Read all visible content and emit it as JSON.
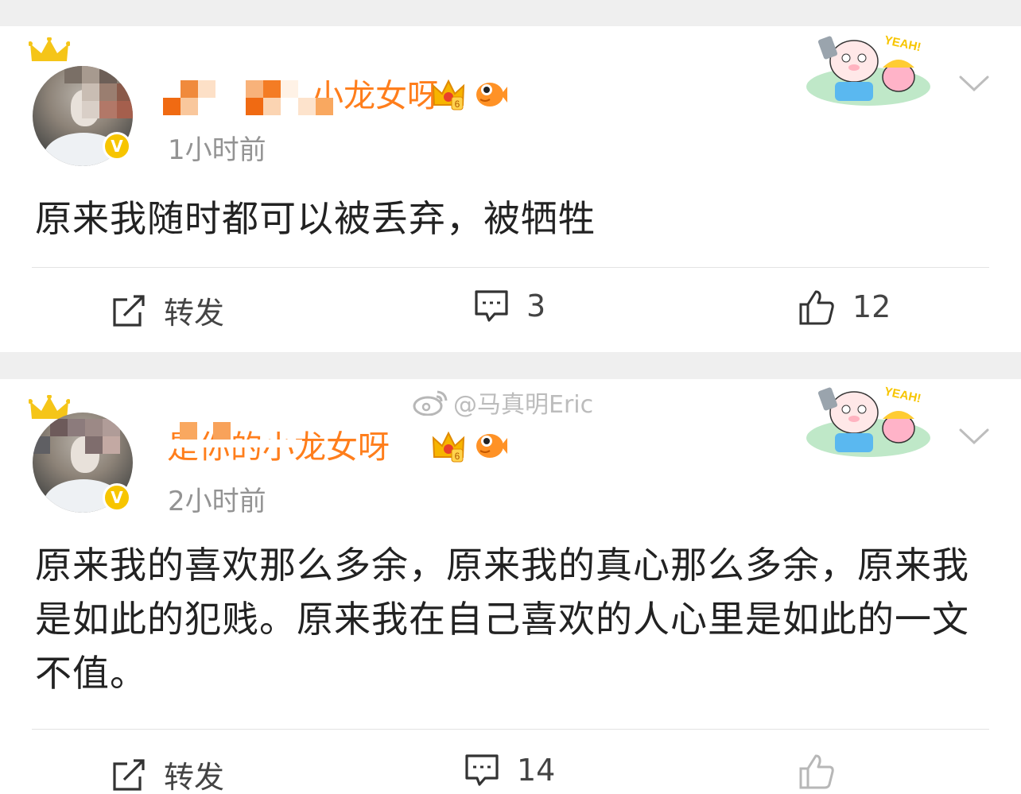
{
  "posts": [
    {
      "username": "小龙女呀",
      "timestamp": "1小时前",
      "content": "原来我随时都可以被丢弃，被牺牲",
      "actions": {
        "repost_label": "转发",
        "comment_count": "3",
        "like_count": "12"
      }
    },
    {
      "username": "是你的小龙女呀",
      "timestamp": "2小时前",
      "content": "原来我的喜欢那么多余，原来我的真心那么多余，原来我是如此的犯贱。原来我在自己喜欢的人心里是如此的一文不值。",
      "actions": {
        "repost_label": "转发",
        "comment_count": "14"
      }
    }
  ],
  "watermark": {
    "text": "@马真明Eric"
  },
  "sticker_text": "YEAH!",
  "colors": {
    "username": "#ff7e1c",
    "verified": "#f7c500",
    "crown": "#f5c518"
  }
}
